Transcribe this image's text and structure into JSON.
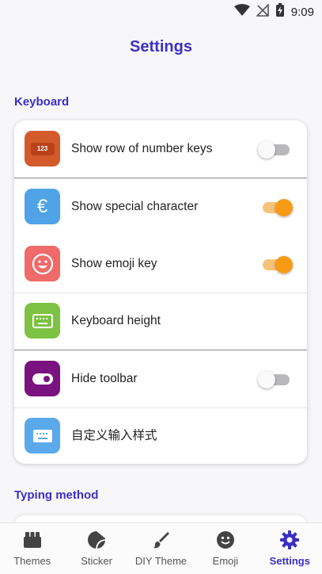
{
  "status_bar": {
    "time": "9:09"
  },
  "header": {
    "title": "Settings"
  },
  "sections": {
    "keyboard": "Keyboard",
    "typing_method": "Typing method"
  },
  "keyboard_settings": [
    {
      "label": "Show row of number keys",
      "icon": "number-keys-icon",
      "icon_text": "123",
      "icon_color": "#d35a2a",
      "toggle": false
    },
    {
      "label": "Show special character",
      "icon": "euro-icon",
      "icon_text": "€",
      "icon_color": "#4fa3e6",
      "toggle": true
    },
    {
      "label": "Show emoji key",
      "icon": "smiley-icon",
      "icon_color": "#f06a6a",
      "toggle": true
    },
    {
      "label": "Keyboard height",
      "icon": "keyboard-icon",
      "icon_color": "#7cc243"
    },
    {
      "label": "Hide toolbar",
      "icon": "toolbar-toggle-icon",
      "icon_color": "#7a127f",
      "toggle": false
    },
    {
      "label": "自定义输入样式",
      "icon": "keyboard-style-icon",
      "icon_color": "#5aa9ea"
    }
  ],
  "bottom_nav": [
    {
      "label": "Themes",
      "icon": "themes-icon"
    },
    {
      "label": "Sticker",
      "icon": "sticker-icon"
    },
    {
      "label": "DIY Theme",
      "icon": "brush-icon"
    },
    {
      "label": "Emoji",
      "icon": "emoji-icon"
    },
    {
      "label": "Settings",
      "icon": "gear-icon",
      "active": true
    }
  ],
  "colors": {
    "accent": "#3b2fc4",
    "toggle_on": "#f79b16",
    "toggle_off": "#b9b9bc"
  }
}
